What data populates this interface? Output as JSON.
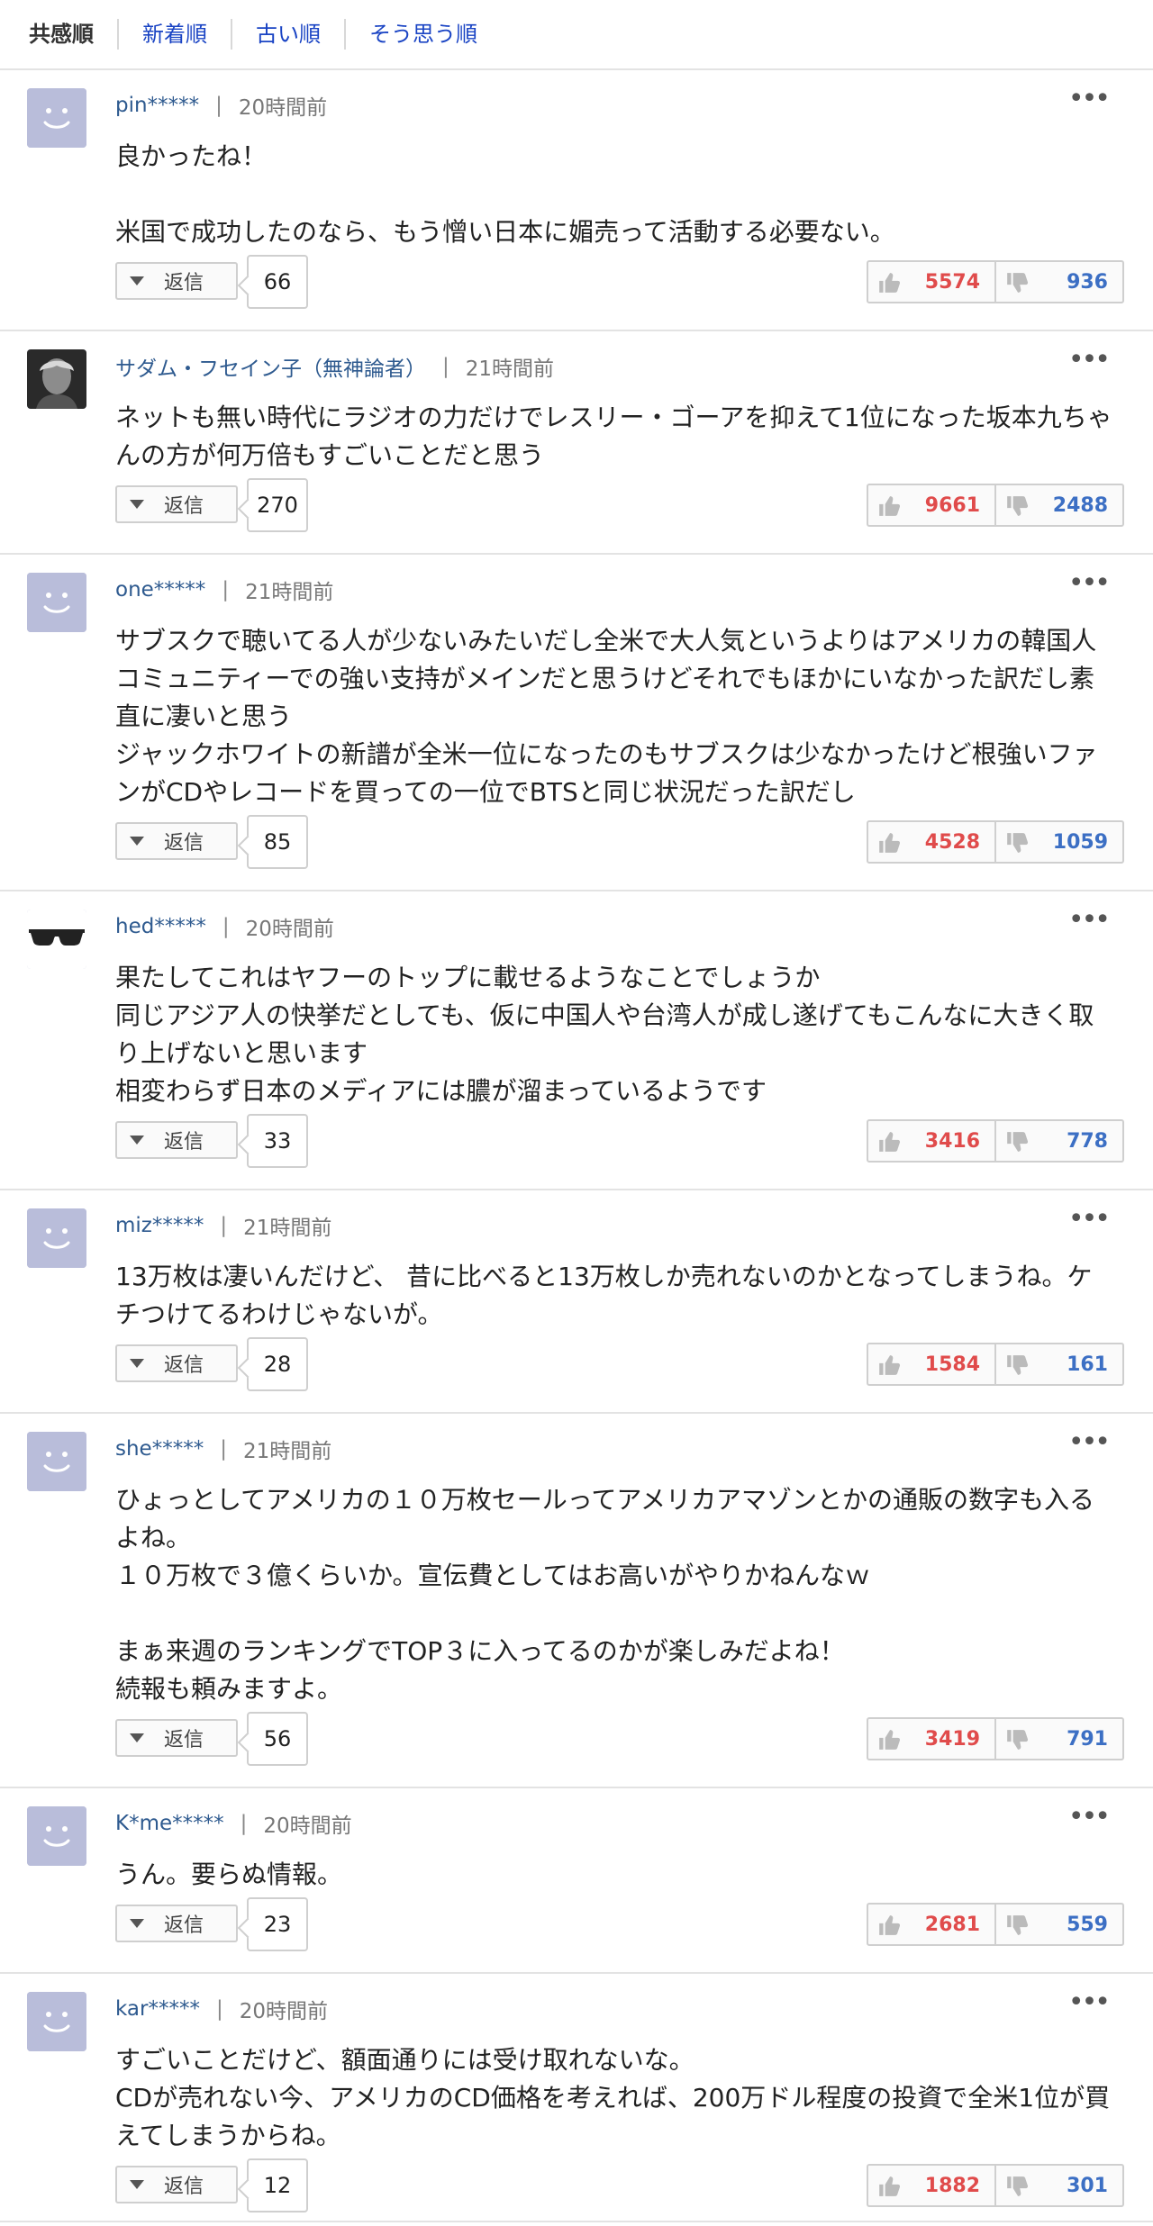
{
  "sort_tabs": [
    "共感順",
    "新着順",
    "古い順",
    "そう思う順"
  ],
  "comments": [
    {
      "user": "pin*****",
      "time": "20時間前",
      "text": "良かったね！\n\n米国で成功したのなら、もう憎い日本に媚売って活動する必要ない。",
      "replies": "66",
      "up": "5574",
      "down": "936",
      "avatar": "default"
    },
    {
      "user": "サダム・フセイン子（無神論者）",
      "time": "21時間前",
      "text": "ネットも無い時代にラジオの力だけでレスリー・ゴーアを抑えて1位になった坂本九ちゃんの方が何万倍もすごいことだと思う",
      "replies": "270",
      "up": "9661",
      "down": "2488",
      "avatar": "photo"
    },
    {
      "user": "one*****",
      "time": "21時間前",
      "text": "サブスクで聴いてる人が少ないみたいだし全米で大人気というよりはアメリカの韓国人コミュニティーでの強い支持がメインだと思うけどそれでもほかにいなかった訳だし素直に凄いと思う\nジャックホワイトの新譜が全米一位になったのもサブスクは少なかったけど根強いファンがCDやレコードを買っての一位でBTSと同じ状況だった訳だし",
      "replies": "85",
      "up": "4528",
      "down": "1059",
      "avatar": "default"
    },
    {
      "user": "hed*****",
      "time": "20時間前",
      "text": "果たしてこれはヤフーのトップに載せるようなことでしょうか\n同じアジア人の快挙だとしても、仮に中国人や台湾人が成し遂げてもこんなに大きく取り上げないと思います\n相変わらず日本のメディアには膿が溜まっているようです",
      "replies": "33",
      "up": "3416",
      "down": "778",
      "avatar": "sunglasses"
    },
    {
      "user": "miz*****",
      "time": "21時間前",
      "text": "13万枚は凄いんだけど、 昔に比べると13万枚しか売れないのかとなってしまうね。ケチつけてるわけじゃないが。",
      "replies": "28",
      "up": "1584",
      "down": "161",
      "avatar": "default"
    },
    {
      "user": "she*****",
      "time": "21時間前",
      "text": "ひょっとしてアメリカの１０万枚セールってアメリカアマゾンとかの通販の数字も入るよね。\n１０万枚で３億くらいか。宣伝費としてはお高いがやりかねんなｗ\n\nまぁ来週のランキングでTOP３に入ってるのかが楽しみだよね！\n続報も頼みますよ。",
      "replies": "56",
      "up": "3419",
      "down": "791",
      "avatar": "default"
    },
    {
      "user": "K*me*****",
      "time": "20時間前",
      "text": "うん。要らぬ情報。",
      "replies": "23",
      "up": "2681",
      "down": "559",
      "avatar": "default"
    },
    {
      "user": "kar*****",
      "time": "20時間前",
      "text": "すごいことだけど、額面通りには受け取れないな。\nCDが売れない今、アメリカのCD価格を考えれば、200万ドル程度の投資で全米1位が買えてしまうからね。",
      "replies": "12",
      "up": "1882",
      "down": "301",
      "avatar": "default"
    }
  ],
  "labels": {
    "reply": "返信",
    "more": "•••"
  }
}
